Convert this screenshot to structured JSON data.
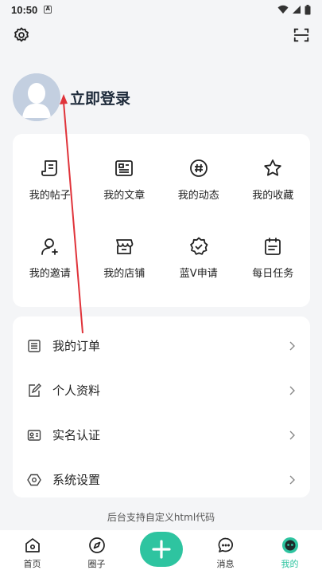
{
  "status_bar": {
    "time": "10:50",
    "notif_icon": "A"
  },
  "profile": {
    "login_label": "立即登录"
  },
  "grid": {
    "items": [
      {
        "label": "我的帖子",
        "icon": "post-icon"
      },
      {
        "label": "我的文章",
        "icon": "article-icon"
      },
      {
        "label": "我的动态",
        "icon": "hashtag-icon"
      },
      {
        "label": "我的收藏",
        "icon": "star-icon"
      },
      {
        "label": "我的邀请",
        "icon": "invite-user-icon"
      },
      {
        "label": "我的店铺",
        "icon": "store-icon"
      },
      {
        "label": "蓝V申请",
        "icon": "verified-badge-icon"
      },
      {
        "label": "每日任务",
        "icon": "calendar-task-icon"
      }
    ]
  },
  "list": {
    "items": [
      {
        "label": "我的订单",
        "icon": "order-list-icon"
      },
      {
        "label": "个人资料",
        "icon": "edit-profile-icon"
      },
      {
        "label": "实名认证",
        "icon": "id-card-icon"
      },
      {
        "label": "系统设置",
        "icon": "hexagon-settings-icon"
      }
    ]
  },
  "footer_note": "后台支持自定义html代码",
  "tabbar": {
    "tabs": [
      {
        "label": "首页",
        "icon": "home-icon"
      },
      {
        "label": "圈子",
        "icon": "compass-icon"
      },
      {
        "label": "",
        "icon": "plus-icon"
      },
      {
        "label": "消息",
        "icon": "chat-icon"
      },
      {
        "label": "我的",
        "icon": "me-face-icon"
      }
    ]
  },
  "colors": {
    "accent": "#2ec4a0",
    "background": "#f4f5f7",
    "annotation_arrow": "#e0333a"
  }
}
